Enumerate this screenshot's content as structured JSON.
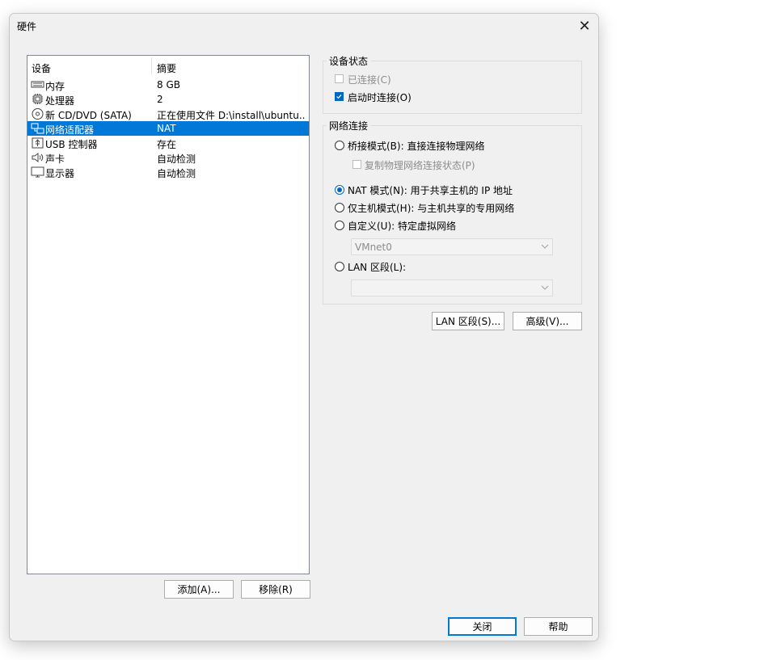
{
  "dialog": {
    "title": "硬件",
    "close_glyph": "✕"
  },
  "device_list": {
    "headers": {
      "device": "设备",
      "summary": "摘要"
    },
    "rows": [
      {
        "name": "内存",
        "summary": "8 GB",
        "icon": "memory-icon",
        "selected": false
      },
      {
        "name": "处理器",
        "summary": "2",
        "icon": "processor-icon",
        "selected": false
      },
      {
        "name": "新 CD/DVD (SATA)",
        "summary": "正在使用文件 D:\\install\\ubuntu...",
        "icon": "cd-dvd-icon",
        "selected": false
      },
      {
        "name": "网络适配器",
        "summary": "NAT",
        "icon": "network-adapter-icon",
        "selected": true
      },
      {
        "name": "USB 控制器",
        "summary": "存在",
        "icon": "usb-icon",
        "selected": false
      },
      {
        "name": "声卡",
        "summary": "自动检测",
        "icon": "speaker-icon",
        "selected": false
      },
      {
        "name": "显示器",
        "summary": "自动检测",
        "icon": "monitor-icon",
        "selected": false
      }
    ]
  },
  "list_buttons": {
    "add": "添加(A)...",
    "remove": "移除(R)"
  },
  "device_status": {
    "title": "设备状态",
    "connected": {
      "label": "已连接(C)",
      "checked": false,
      "enabled": false
    },
    "connect_at_power_on": {
      "label": "启动时连接(O)",
      "checked": true,
      "enabled": true
    }
  },
  "network_connection": {
    "title": "网络连接",
    "bridged": {
      "label": "桥接模式(B): 直接连接物理网络",
      "selected": false
    },
    "replicate": {
      "label": "复制物理网络连接状态(P)",
      "checked": false,
      "enabled": false
    },
    "nat": {
      "label": "NAT 模式(N): 用于共享主机的 IP 地址",
      "selected": true
    },
    "host_only": {
      "label": "仅主机模式(H): 与主机共享的专用网络",
      "selected": false
    },
    "custom": {
      "label": "自定义(U): 特定虚拟网络",
      "selected": false
    },
    "custom_network_value": "VMnet0",
    "lan_segment": {
      "label": "LAN 区段(L):",
      "selected": false
    },
    "lan_segment_value": ""
  },
  "right_buttons": {
    "lan_segments": "LAN 区段(S)...",
    "advanced": "高级(V)..."
  },
  "footer": {
    "close": "关闭",
    "help": "帮助"
  },
  "colors": {
    "selection": "#0078d7",
    "accent": "#0067c0",
    "dialog_bg": "#f0f0f0"
  }
}
